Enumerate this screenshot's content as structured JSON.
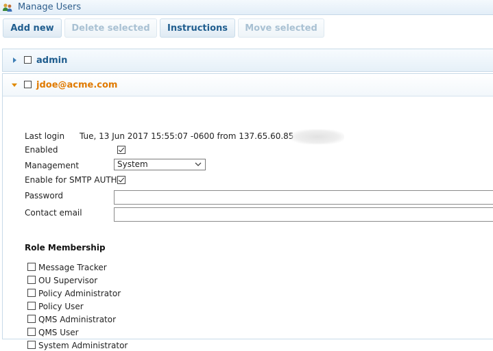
{
  "window": {
    "title": "Manage Users"
  },
  "toolbar": {
    "add_new": "Add new",
    "delete_selected": "Delete selected",
    "instructions": "Instructions",
    "move_selected": "Move selected"
  },
  "users": [
    {
      "name": "admin",
      "expanded": false
    },
    {
      "name": "jdoe@acme.com",
      "expanded": true
    }
  ],
  "details": {
    "last_login_label": "Last login",
    "last_login_value": "Tue, 13 Jun 2017 15:55:07 -0600 from 137.65.60.85",
    "enabled_label": "Enabled",
    "enabled": true,
    "management_label": "Management",
    "management_value": "System",
    "smtp_label": "Enable for SMTP AUTH",
    "smtp_enabled": true,
    "password_label": "Password",
    "password_value": "",
    "contact_email_label": "Contact email",
    "contact_email_value": ""
  },
  "roles": {
    "heading": "Role Membership",
    "items": [
      {
        "label": "Message Tracker",
        "checked": false
      },
      {
        "label": "OU Supervisor",
        "checked": false
      },
      {
        "label": "Policy Administrator",
        "checked": false
      },
      {
        "label": "Policy User",
        "checked": false
      },
      {
        "label": "QMS Administrator",
        "checked": false
      },
      {
        "label": "QMS User",
        "checked": false
      },
      {
        "label": "System Administrator",
        "checked": false
      }
    ]
  },
  "colors": {
    "accent_blue": "#1f5d8e",
    "accent_orange": "#e07a00",
    "border": "#c8dae8"
  },
  "icons": {
    "app": "users-icon",
    "collapsed": "caret-right-icon",
    "expanded": "caret-down-icon",
    "dropdown": "chevron-down-icon"
  }
}
